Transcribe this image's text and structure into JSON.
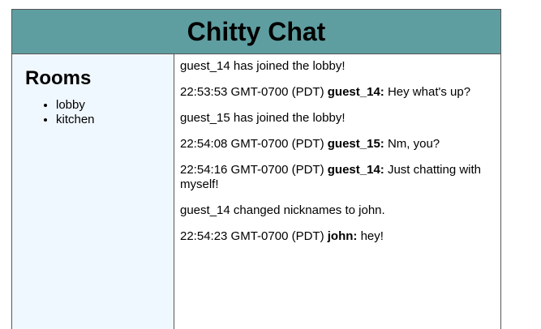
{
  "header": {
    "title": "Chitty Chat"
  },
  "sidebar": {
    "title": "Rooms",
    "rooms": [
      "lobby",
      "kitchen"
    ]
  },
  "messages": [
    {
      "type": "system",
      "text": "guest_14 has joined the lobby!"
    },
    {
      "type": "chat",
      "time": "22:53:53 GMT-0700 (PDT)",
      "nick": "guest_14:",
      "text": "Hey what's up?"
    },
    {
      "type": "system",
      "text": "guest_15 has joined the lobby!"
    },
    {
      "type": "chat",
      "time": "22:54:08 GMT-0700 (PDT)",
      "nick": "guest_15:",
      "text": "Nm, you?"
    },
    {
      "type": "chat",
      "time": "22:54:16 GMT-0700 (PDT)",
      "nick": "guest_14:",
      "text": "Just chatting with myself!"
    },
    {
      "type": "system",
      "text": "guest_14 changed nicknames to john."
    },
    {
      "type": "chat",
      "time": "22:54:23 GMT-0700 (PDT)",
      "nick": "john:",
      "text": "hey!"
    }
  ]
}
